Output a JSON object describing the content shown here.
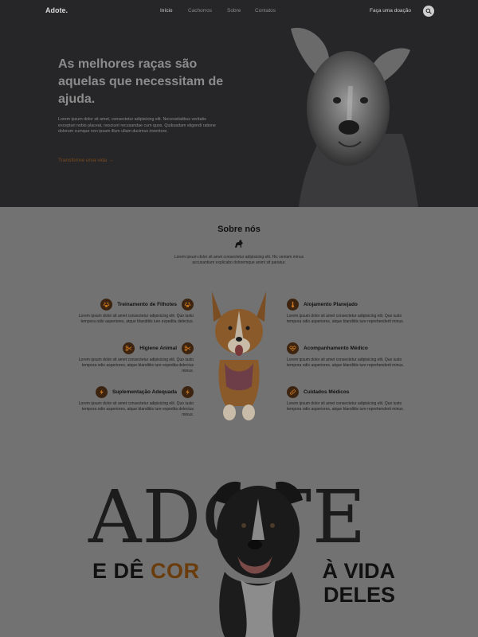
{
  "nav": {
    "logo": "Adote.",
    "links": [
      "Início",
      "Cachorros",
      "Sobre",
      "Contatos"
    ],
    "donate": "Faça uma doação",
    "search_icon": "search-icon"
  },
  "hero": {
    "title": "As melhores raças são aquelas que necessitam de ajuda.",
    "text": "Lorem ipsum dolor sit amet, consectetur adipisicing elit. Necessitatibus veritatis excepturi nobis placeat, nesciunt recusandae cum quos. Quibusdam eligendi ratione dolorum cumque non ipsam illum ullam ducimus inventore.",
    "cta": "Transforme uma vida →"
  },
  "about": {
    "title": "Sobre nós",
    "text": "Lorem ipsum dolor sit amet consectetur adipisicing elit. Hic veniam minus accusantium explicabo doloremque animi sit pariatur.",
    "features": [
      {
        "title": "Treinamento de Filhotes",
        "icon": "paw-badge-icon",
        "text": "Lorem ipsum dolor sit amet consectetur adipisicing elit. Quo iusto tempora odio asperiores, atque blanditiis iure expedita delectus."
      },
      {
        "title": "Alojamento Planejado",
        "icon": "thermometer-icon",
        "text": "Lorem ipsum dolor sit amet consectetur adipisicing elit. Quo iusto tempora odio asperiores, atque blanditiis iure reprehenderit minus."
      },
      {
        "title": "Higiene Animal",
        "icon": "scissors-icon",
        "text": "Lorem ipsum dolor sit amet consectetur adipisicing elit. Quo iusto tempora odio asperiores, atque blanditiis iure expedita delectus minus."
      },
      {
        "title": "Acompanhamento Médico",
        "icon": "heart-pulse-icon",
        "text": "Lorem ipsum dolor sit amet consectetur adipisicing elit. Quo iusto tempora odio asperiores, atque blanditiis iure reprehenderit minus."
      },
      {
        "title": "Suplementação Adequada",
        "icon": "lightning-icon",
        "text": "Lorem ipsum dolor sit amet consectetur adipisicing elit. Quo iusto tempora odio asperiores, atque blanditiis iure expedita delectus minus."
      },
      {
        "title": "Cuidados Médicos",
        "icon": "bandage-icon",
        "text": "Lorem ipsum dolor sit amet consectetur adipisicing elit. Quo iusto tempora odio asperiores, atque blanditiis iure reprehenderit minus."
      }
    ]
  },
  "banner": {
    "big_word": "ADOTE",
    "slogan_a": "E DÊ ",
    "slogan_accent": "COR",
    "slogan_b": "À VIDA",
    "slogan_c": "DELES"
  },
  "colors": {
    "hero_bg": "#262628",
    "page_bg": "#727272",
    "accent": "#6a3c0c"
  }
}
